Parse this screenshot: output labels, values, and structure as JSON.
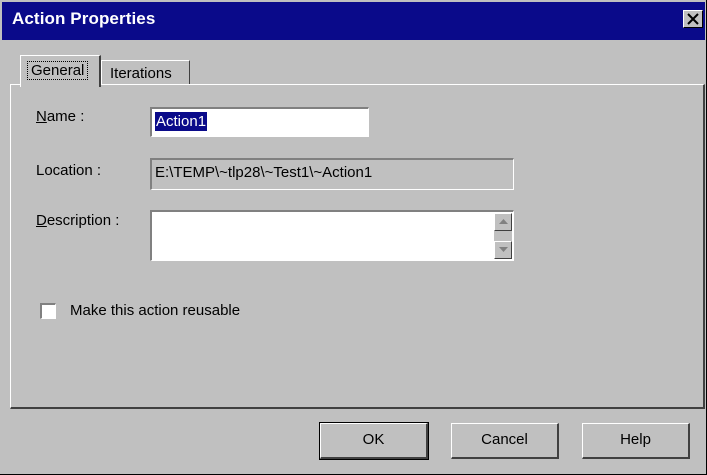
{
  "window": {
    "title": "Action Properties",
    "close_icon": "close-icon"
  },
  "tabs": [
    {
      "label": "General",
      "active": true
    },
    {
      "label": "Iterations",
      "active": false
    }
  ],
  "form": {
    "name_label_prefix": "N",
    "name_label_rest": "ame :",
    "name_value": "Action1",
    "location_label": "Location :",
    "location_value": "E:\\TEMP\\~tlp28\\~Test1\\~Action1",
    "description_label_prefix": "D",
    "description_label_rest": "escription :",
    "description_value": "",
    "reusable_label": "Make this action reusable",
    "reusable_checked": false
  },
  "buttons": {
    "ok": "OK",
    "cancel": "Cancel",
    "help": "Help"
  },
  "colors": {
    "title_bar": "#0a0a8a",
    "dialog_bg": "#c0c0c0",
    "selection": "#0a0a8a"
  }
}
